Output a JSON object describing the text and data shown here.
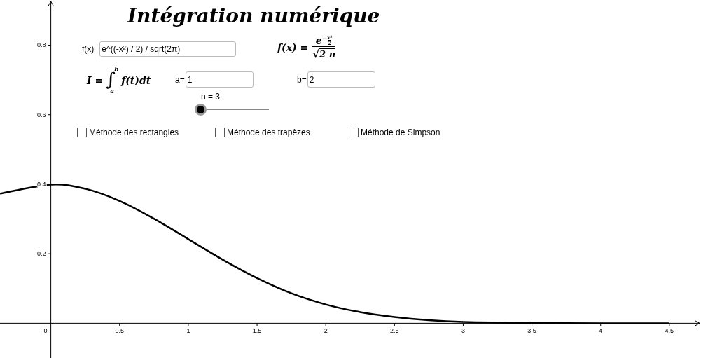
{
  "title": "Intégration numérique",
  "function_input": {
    "label": "f(x)=",
    "value": "e^((-x²) / 2) / sqrt(2π)"
  },
  "formula": {
    "lhs": "f(x) =",
    "base": "e",
    "exponent_sign": "−",
    "exponent_numerator": "x²",
    "exponent_denominator": "2",
    "radical": "√",
    "radicand": "2 π"
  },
  "integral": {
    "lhs": "I =",
    "symbol": "∫",
    "upper": "b",
    "lower": "a",
    "integrand": "f(t)dt"
  },
  "bounds": [
    {
      "label": "a=",
      "value": "1"
    },
    {
      "label": "b=",
      "value": "2"
    }
  ],
  "slider": {
    "label": "n = 3",
    "level": 0
  },
  "checkboxes": [
    {
      "label": "Méthode des rectangles",
      "checked": false
    },
    {
      "label": "Méthode des trapèzes",
      "checked": false
    },
    {
      "label": "Méthode de Simpson",
      "checked": false
    }
  ],
  "graph": {
    "origin_label": "0",
    "chart_data": {
      "type": "line",
      "xlim": [
        -0.37,
        4.73
      ],
      "ylim": [
        -0.1,
        0.93
      ],
      "xticks": [
        {
          "value": 0.5,
          "label": "0.5"
        },
        1,
        {
          "value": 1.5,
          "label": "1.5"
        },
        2,
        {
          "value": 2.5,
          "label": "2.5"
        },
        3,
        {
          "value": 3.5,
          "label": "3.5"
        },
        4,
        {
          "value": 4.5,
          "label": "4.5"
        }
      ],
      "yticks": [
        {
          "value": 0.2,
          "label": "0.2"
        },
        {
          "value": 0.4,
          "label": "0.4"
        },
        {
          "value": 0.6,
          "label": "0.6"
        },
        {
          "value": 0.8,
          "label": "0.8"
        }
      ],
      "x": [
        -0.37,
        0,
        0.25,
        0.5,
        0.75,
        1,
        1.25,
        1.5,
        1.75,
        2,
        2.25,
        2.5,
        2.75,
        3,
        3.5,
        4,
        4.5
      ],
      "series": [
        {
          "color": "#000000",
          "values": [
            0.373,
            0.399,
            0.387,
            0.352,
            0.301,
            0.242,
            0.183,
            0.13,
            0.086,
            0.054,
            0.032,
            0.018,
            0.009,
            0.004,
            0.001,
            0,
            0
          ]
        }
      ]
    }
  }
}
